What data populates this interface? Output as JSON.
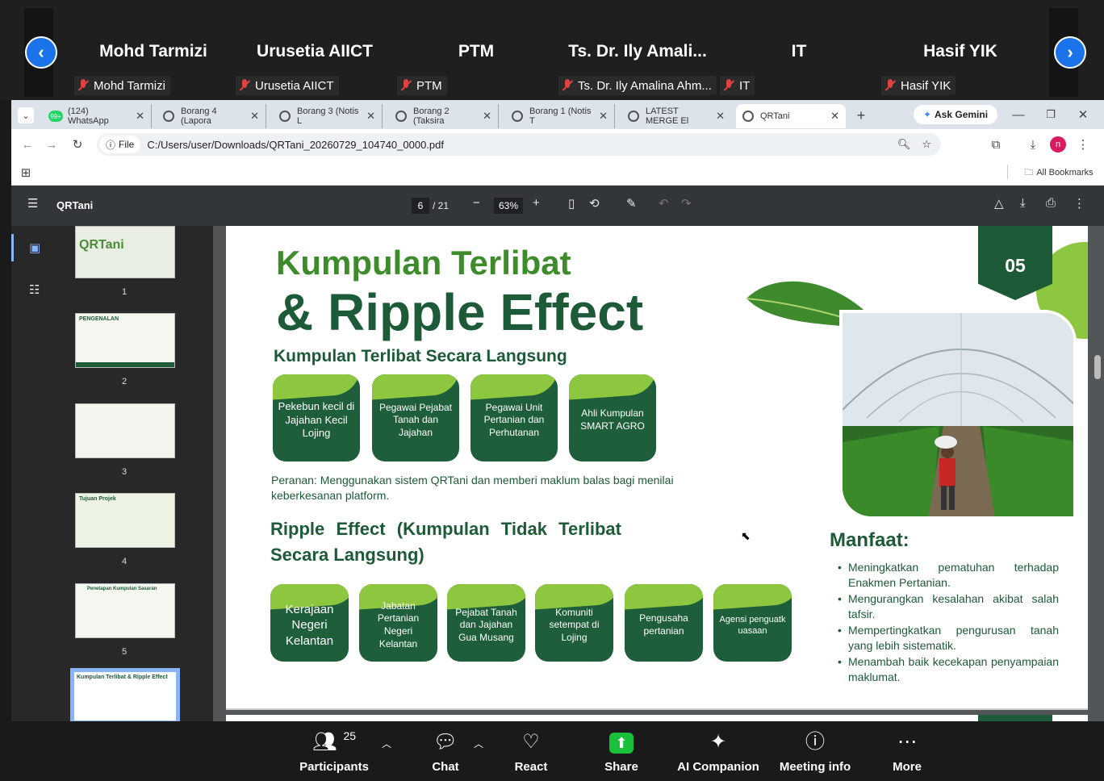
{
  "meeting": {
    "participants": [
      {
        "big": "Mohd Tarmizi",
        "tag": "Mohd Tarmizi"
      },
      {
        "big": "Urusetia AIICT",
        "tag": "Urusetia AIICT"
      },
      {
        "big": "PTM",
        "tag": "PTM"
      },
      {
        "big": "Ts. Dr. Ily Amali...",
        "tag": "Ts. Dr. Ily Amalina Ahm..."
      },
      {
        "big": "IT",
        "tag": "IT"
      },
      {
        "big": "Hasif YIK",
        "tag": "Hasif YIK"
      }
    ],
    "participant_count": "25",
    "toolbar": {
      "participants": "Participants",
      "chat": "Chat",
      "react": "React",
      "share": "Share",
      "ai": "AI Companion",
      "info": "Meeting info",
      "more": "More"
    }
  },
  "browser": {
    "tabs": [
      "(124) WhatsApp",
      "Borang 4 (Lapora",
      "Borang 3 (Notis L",
      "Borang 2 (Taksira",
      "Borang 1 (Notis T",
      "LATEST MERGE El",
      "QRTani"
    ],
    "wa_badge": "99+",
    "ask": "Ask Gemini",
    "file_chip": "File",
    "url": "C:/Users/user/Downloads/QRTani_20260729_104740_0000.pdf",
    "bookmarks": "All Bookmarks",
    "profile": "n"
  },
  "pdf": {
    "title": "QRTani",
    "page": "6",
    "total": "/ 21",
    "zoom": "63%",
    "thumbs": [
      "1",
      "2",
      "3",
      "4",
      "5"
    ],
    "thumb_titles": [
      "QRTani",
      "PENGENALAN",
      "",
      "Tujuan Projek",
      "Penetapan Kumpulan Sasaran",
      "Kumpulan Terlibat & Ripple Effect"
    ]
  },
  "slide": {
    "h1a": "Kumpulan Terlibat",
    "h1b": "& Ripple Effect",
    "h2": "Kumpulan Terlibat Secara Langsung",
    "badge": "05",
    "direct": [
      "Pekebun kecil di Jajahan Kecil Lojing",
      "Pegawai Pejabat Tanah dan Jajahan",
      "Pegawai Unit Pertanian dan Perhutanan",
      "Ahli Kumpulan SMART AGRO"
    ],
    "role": "Peranan: Menggunakan sistem QRTani dan memberi maklum balas bagi menilai keberkesanan platform.",
    "ripple": "Ripple Effect (Kumpulan Tidak Terlibat Secara Langsung)",
    "indirect": [
      "Kerajaan Negeri Kelantan",
      "Jabatan Pertanian Negeri Kelantan",
      "Pejabat Tanah dan Jajahan Gua Musang",
      "Komuniti setempat di Lojing",
      "Pengusaha pertanian",
      "Agensi penguatkuasaan"
    ],
    "manfaat": "Manfaat:",
    "benefits": [
      "Meningkatkan pematuhan terhadap Enakmen Pertanian.",
      "Mengurangkan kesalahan akibat salah tafsir.",
      "Mempertingkatkan pengurusan tanah yang lebih sistematik.",
      "Menambah baik kecekapan penyampaian maklumat."
    ]
  }
}
